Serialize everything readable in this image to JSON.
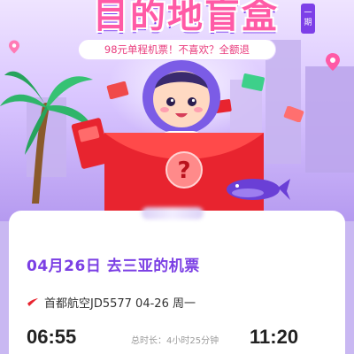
{
  "banner": {
    "title": "目的地盲盒",
    "issue_tag": "一期",
    "subtitle": "98元单程机票！不喜欢？全额退"
  },
  "ticket": {
    "trip_title": "04月26日 去三亚的机票",
    "airline_info": "首都航空JD5577 04-26 周一",
    "departure_time": "06:55",
    "arrival_time": "11:20",
    "duration": "总时长：4小时25分钟"
  },
  "icons": {
    "airline_logo": "airline-logo-icon",
    "question_mark": "question-mark-icon",
    "location_marker": "location-marker-icon"
  },
  "colors": {
    "accent_purple": "#7b3fe4",
    "title_pink": "#ff5aa6",
    "envelope_red": "#e8242f"
  }
}
